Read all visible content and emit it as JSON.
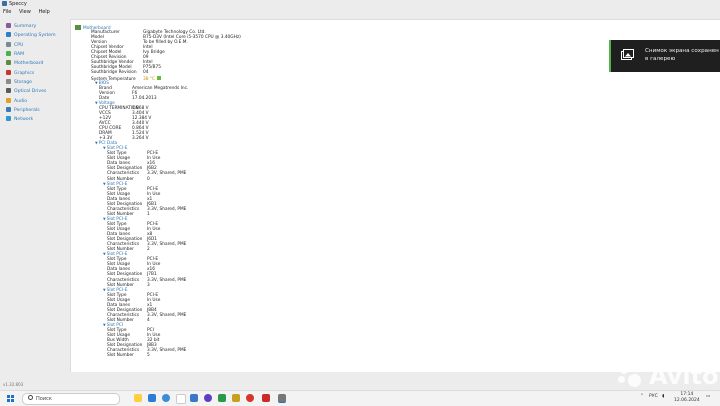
{
  "window": {
    "title": "Speccy"
  },
  "menu": [
    "File",
    "View",
    "Help"
  ],
  "sidebar": {
    "items": [
      {
        "label": "Summary",
        "color": "#8b5a9a"
      },
      {
        "label": "Operating System",
        "color": "#2a7fc8"
      },
      {
        "label": "CPU",
        "color": "#7a8a95"
      },
      {
        "label": "RAM",
        "color": "#4caf50"
      },
      {
        "label": "Motherboard",
        "color": "#5a8e3a"
      },
      {
        "label": "Graphics",
        "color": "#c43a2a"
      },
      {
        "label": "Storage",
        "color": "#8a8a8a"
      },
      {
        "label": "Optical Drives",
        "color": "#5a5a5a"
      },
      {
        "label": "Audio",
        "color": "#e0a020"
      },
      {
        "label": "Peripherals",
        "color": "#3a7ab8"
      },
      {
        "label": "Network",
        "color": "#2a9bd0"
      }
    ]
  },
  "main": {
    "title": "Motherboard",
    "info": [
      [
        "Manufacturer",
        "Gigabyte Technology Co. Ltd."
      ],
      [
        "Model",
        "B75-D3V (Intel Core i5-3570 CPU @ 3.40GHz)"
      ],
      [
        "Version",
        "To be filled by O.E.M."
      ],
      [
        "Chipset Vendor",
        "Intel"
      ],
      [
        "Chipset Model",
        "Ivy Bridge"
      ],
      [
        "Chipset Revision",
        "09"
      ],
      [
        "Southbridge Vendor",
        "Intel"
      ],
      [
        "Southbridge Model",
        "P75/B75"
      ],
      [
        "Southbridge Revision",
        "04"
      ],
      [
        "System Temperature",
        "38 °C"
      ]
    ],
    "bios": {
      "title": "BIOS",
      "rows": [
        [
          "Brand",
          "American Megatrends Inc."
        ],
        [
          "Version",
          "F6"
        ],
        [
          "Date",
          "17.04.2013"
        ]
      ]
    },
    "voltage": {
      "title": "Voltage",
      "rows": [
        [
          "CPU TERMINATION",
          "1.068 V"
        ],
        [
          "VCCS",
          "3.404 V"
        ],
        [
          "+12V",
          "12.384 V"
        ],
        [
          "AVCC",
          "3.440 V"
        ],
        [
          "CPU CORE",
          "0.864 V"
        ],
        [
          "DRAM",
          "1.524 V"
        ],
        [
          "+3.3V",
          "3.264 V"
        ]
      ]
    },
    "pci": {
      "title": "PCI Data",
      "slots": [
        {
          "title": "Slot PCI-E",
          "rows": [
            [
              "Slot Type",
              "PCI-E"
            ],
            [
              "Slot Usage",
              "In Use"
            ],
            [
              "Data lanes",
              "x16"
            ],
            [
              "Slot Designation",
              "J6B2"
            ],
            [
              "Characteristics",
              "3.3V, Shared, PME"
            ],
            [
              "Slot Number",
              "0"
            ]
          ]
        },
        {
          "title": "Slot PCI-E",
          "rows": [
            [
              "Slot Type",
              "PCI-E"
            ],
            [
              "Slot Usage",
              "In Use"
            ],
            [
              "Data lanes",
              "x1"
            ],
            [
              "Slot Designation",
              "J6B1"
            ],
            [
              "Characteristics",
              "3.3V, Shared, PME"
            ],
            [
              "Slot Number",
              "1"
            ]
          ]
        },
        {
          "title": "Slot PCI-E",
          "rows": [
            [
              "Slot Type",
              "PCI-E"
            ],
            [
              "Slot Usage",
              "In Use"
            ],
            [
              "Data lanes",
              "x8"
            ],
            [
              "Slot Designation",
              "J6D1"
            ],
            [
              "Characteristics",
              "3.3V, Shared, PME"
            ],
            [
              "Slot Number",
              "2"
            ]
          ]
        },
        {
          "title": "Slot PCI-E",
          "rows": [
            [
              "Slot Type",
              "PCI-E"
            ],
            [
              "Slot Usage",
              "In Use"
            ],
            [
              "Data lanes",
              "x16"
            ],
            [
              "Slot Designation",
              "J7B1"
            ],
            [
              "Characteristics",
              "3.3V, Shared, PME"
            ],
            [
              "Slot Number",
              "3"
            ]
          ]
        },
        {
          "title": "Slot PCI-E",
          "rows": [
            [
              "Slot Type",
              "PCI-E"
            ],
            [
              "Slot Usage",
              "In Use"
            ],
            [
              "Data lanes",
              "x1"
            ],
            [
              "Slot Designation",
              "J8B4"
            ],
            [
              "Characteristics",
              "3.3V, Shared, PME"
            ],
            [
              "Slot Number",
              "4"
            ]
          ]
        },
        {
          "title": "Slot PCI",
          "rows": [
            [
              "Slot Type",
              "PCI"
            ],
            [
              "Slot Usage",
              "In Use"
            ],
            [
              "Bus Width",
              "32 bit"
            ],
            [
              "Slot Designation",
              "J8B3"
            ],
            [
              "Characteristics",
              "3.3V, Shared, PME"
            ],
            [
              "Slot Number",
              "5"
            ]
          ]
        }
      ]
    }
  },
  "version_text": "v1.32.803",
  "toast": {
    "line1": "Снимок экрана сохранен",
    "line2": "в галерею"
  },
  "taskbar": {
    "search_placeholder": "Поиск",
    "tray_lang": "РУС",
    "time": "17:14",
    "date": "12.06.2024"
  },
  "watermark": "Avito"
}
